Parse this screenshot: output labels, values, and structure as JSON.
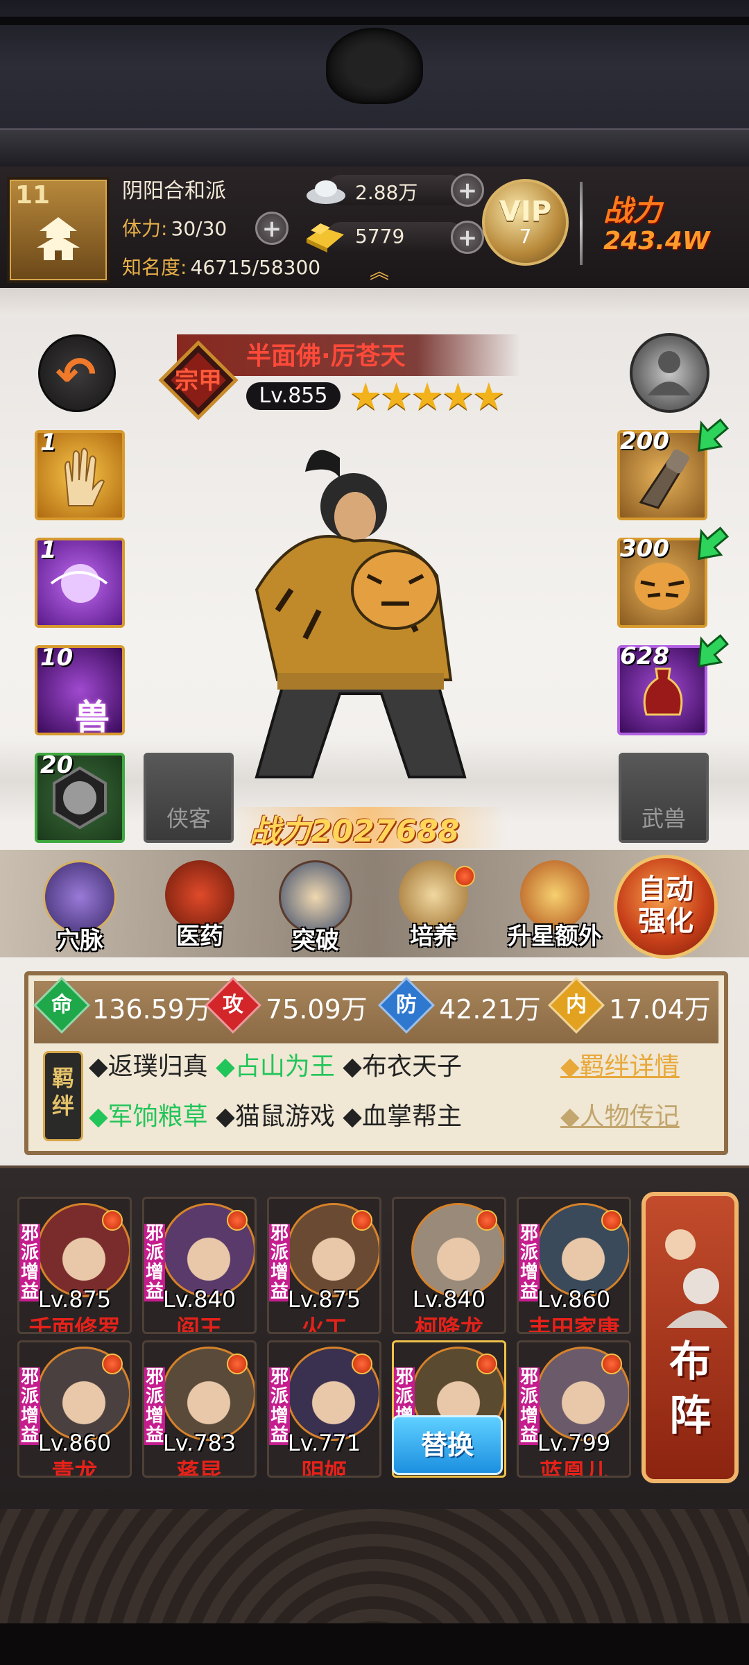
{
  "header": {
    "player_level": "11",
    "guild_name": "阴阳合和派",
    "stamina_label": "体力:",
    "stamina_value": "30/30",
    "fame_label": "知名度:",
    "fame_value": "46715/58300",
    "silver": "2.88万",
    "gold": "5779",
    "vip_text": "VIP",
    "vip_level": "7",
    "power_label": "战力",
    "power_value": "243.4W"
  },
  "hero": {
    "name": "半面佛·厉苍天",
    "level": "Lv.855",
    "stars": "★★★★★",
    "star_count": 5,
    "emblem": "宗甲",
    "power": "战力2027688"
  },
  "skills": [
    {
      "count": "1",
      "icon": "palm-skill-icon"
    },
    {
      "count": "1",
      "icon": "fist-skill-icon"
    },
    {
      "count": "10",
      "icon": "beast-skill-icon",
      "glyph": "兽"
    },
    {
      "count": "20",
      "icon": "medal-skill-icon"
    }
  ],
  "equips": [
    {
      "count": "200",
      "icon": "gauntlet-icon"
    },
    {
      "count": "300",
      "icon": "tiger-armor-icon"
    },
    {
      "count": "628",
      "icon": "vase-icon"
    }
  ],
  "empty_slots": {
    "companion": "侠客",
    "beast": "武兽"
  },
  "functions": [
    {
      "label": "穴脉",
      "icon": "meridian-icon",
      "badge": false
    },
    {
      "label": "医药",
      "icon": "medicine-icon",
      "badge": false
    },
    {
      "label": "突破",
      "icon": "breakthrough-icon",
      "badge": false
    },
    {
      "label": "培养",
      "icon": "cultivate-icon",
      "badge": true
    },
    {
      "label": "升星额外",
      "icon": "star-up-icon",
      "badge": false
    }
  ],
  "auto_button": {
    "line1": "自动",
    "line2": "强化"
  },
  "stats": [
    {
      "icon_text": "命",
      "value": "136.59万",
      "color": "#1fa84a"
    },
    {
      "icon_text": "攻",
      "value": "75.09万",
      "color": "#d3262a"
    },
    {
      "icon_text": "防",
      "value": "42.21万",
      "color": "#2f78d0"
    },
    {
      "icon_text": "内",
      "value": "17.04万",
      "color": "#e2a21f"
    }
  ],
  "bonds": {
    "tag": "羁绊",
    "row1": [
      {
        "text": "◆返璞归真",
        "active": false
      },
      {
        "text": "◆占山为王",
        "active": true
      },
      {
        "text": "◆布衣天子",
        "active": false
      }
    ],
    "row2": [
      {
        "text": "◆军饷粮草",
        "active": true
      },
      {
        "text": "◆猫鼠游戏",
        "active": false
      },
      {
        "text": "◆血掌帮主",
        "active": false
      }
    ],
    "detail_link": "◆羁绊详情",
    "bio_link": "◆人物传记"
  },
  "team": [
    {
      "level": "Lv.875",
      "name": "千面修罗",
      "tag": "邪派增益",
      "color": "#7a2c2c"
    },
    {
      "level": "Lv.840",
      "name": "阎王",
      "tag": "邪派增益",
      "color": "#5a3a6a"
    },
    {
      "level": "Lv.875",
      "name": "火工",
      "tag": "邪派增益",
      "color": "#6a4a32"
    },
    {
      "level": "Lv.840",
      "name": "柯降龙",
      "tag": "",
      "color": "#9a8a7a"
    },
    {
      "level": "Lv.860",
      "name": "丰田家康",
      "tag": "邪派增益",
      "color": "#3a4a5a"
    },
    {
      "level": "Lv.860",
      "name": "青龙",
      "tag": "邪派增益",
      "color": "#4a4040"
    },
    {
      "level": "Lv.783",
      "name": "蒋昆",
      "tag": "邪派增益",
      "color": "#5a4a3a"
    },
    {
      "level": "Lv.771",
      "name": "阴姬",
      "tag": "邪派增益",
      "color": "#3a3050"
    },
    {
      "level": "",
      "name": "",
      "tag": "邪派增益",
      "color": "#5a4a30"
    },
    {
      "level": "Lv.799",
      "name": "蓝凰儿",
      "tag": "邪派增益",
      "color": "#6a5a6a"
    }
  ],
  "swap_button": "替换",
  "formation_button": {
    "line1": "布",
    "line2": "阵"
  }
}
